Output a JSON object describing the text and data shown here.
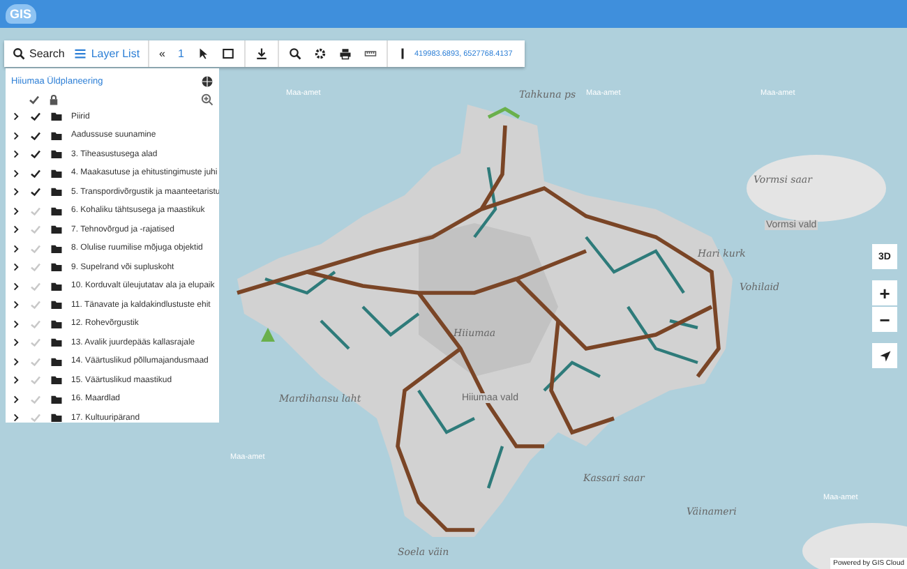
{
  "header": {
    "logo": "GIS"
  },
  "toolbar": {
    "search": "Search",
    "layer_list": "Layer List",
    "page_prev": "«",
    "page": "1",
    "coordinates": "419983.6893, 6527768.4137"
  },
  "layer_panel": {
    "title": "Hiiumaa Üldplaneering",
    "layers": [
      {
        "label": "Piirid",
        "checked": true
      },
      {
        "label": "Aadussuse suunamine",
        "checked": true
      },
      {
        "label": "3. Tiheasustusega alad",
        "checked": true
      },
      {
        "label": "4. Maakasutuse ja ehitustingimuste juhi",
        "checked": true
      },
      {
        "label": "5. Transpordivõrgustik ja maanteetaristu",
        "checked": true
      },
      {
        "label": "6. Kohaliku tähtsusega ja maastikuk",
        "checked": false
      },
      {
        "label": "7. Tehnovõrgud ja -rajatised",
        "checked": false
      },
      {
        "label": "8. Olulise ruumilise mõjuga objektid",
        "checked": false
      },
      {
        "label": "9. Supelrand või supluskoht",
        "checked": false
      },
      {
        "label": "10. Korduvalt üleujutatav ala ja elupaik",
        "checked": false
      },
      {
        "label": "11. Tänavate ja kaldakindlustuste ehit",
        "checked": false
      },
      {
        "label": "12. Rohevõrgustik",
        "checked": false
      },
      {
        "label": "13. Avalik juurdepääs kallasrajale",
        "checked": false
      },
      {
        "label": "14. Väärtuslikud põllumajandusmaad",
        "checked": false
      },
      {
        "label": "15. Väärtuslikud maastikud",
        "checked": false
      },
      {
        "label": "16. Maardlad",
        "checked": false
      },
      {
        "label": "17. Kultuuripärand",
        "checked": false
      }
    ]
  },
  "map": {
    "labels": [
      {
        "text": "Tahkuna ps",
        "kind": "place"
      },
      {
        "text": "Vormsi saar",
        "kind": "place"
      },
      {
        "text": "Vormsi vald",
        "kind": "admin"
      },
      {
        "text": "Hari kurk",
        "kind": "place"
      },
      {
        "text": "Vohilaid",
        "kind": "place"
      },
      {
        "text": "Hiiumaa",
        "kind": "place"
      },
      {
        "text": "Hiiumaa vald",
        "kind": "admin"
      },
      {
        "text": "Mardihansu laht",
        "kind": "place"
      },
      {
        "text": "Kassari saar",
        "kind": "place"
      },
      {
        "text": "Väinameri",
        "kind": "place"
      },
      {
        "text": "Soela väin",
        "kind": "place"
      },
      {
        "text": "Maa-amet",
        "kind": "credit"
      },
      {
        "text": "Maa-amet",
        "kind": "credit"
      },
      {
        "text": "Maa-amet",
        "kind": "credit"
      },
      {
        "text": "Maa-amet",
        "kind": "credit"
      },
      {
        "text": "Maa-amet",
        "kind": "credit"
      }
    ],
    "view_3d": "3D",
    "zoom_in": "+",
    "zoom_out": "−",
    "attribution": "Powered by GIS Cloud"
  }
}
